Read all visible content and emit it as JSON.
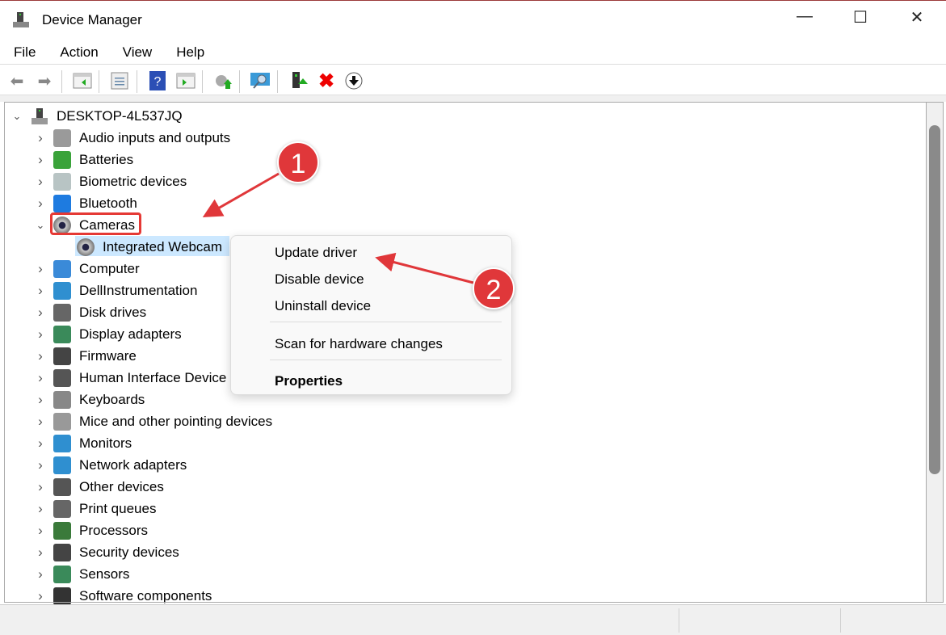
{
  "window": {
    "title": "Device Manager",
    "minimize": "—",
    "maximize": "☐",
    "close": "✕"
  },
  "menu": [
    "File",
    "Action",
    "View",
    "Help"
  ],
  "toolbar": [
    "back-icon",
    "forward-icon",
    "show-hide-console-tree-icon",
    "properties-icon",
    "help-icon",
    "action-pane-icon",
    "update-driver-icon",
    "scan-hardware-icon",
    "enable-device-icon",
    "uninstall-device-icon",
    "disable-device-icon"
  ],
  "tree": {
    "root": "DESKTOP-4L537JQ",
    "items": [
      {
        "label": "Audio inputs and outputs",
        "color": "#9a9a9a"
      },
      {
        "label": "Batteries",
        "color": "#3aa33a"
      },
      {
        "label": "Biometric devices",
        "color": "#b8c4c4"
      },
      {
        "label": "Bluetooth",
        "color": "#1e7be0"
      },
      {
        "label": "Cameras",
        "color": "#777777",
        "expanded": true
      },
      {
        "label": "Integrated Webcam",
        "color": "#777777",
        "child": true
      },
      {
        "label": "Computer",
        "color": "#3a8ad8"
      },
      {
        "label": "DellInstrumentation",
        "color": "#2f8fd0"
      },
      {
        "label": "Disk drives",
        "color": "#666666"
      },
      {
        "label": "Display adapters",
        "color": "#3a8a5a"
      },
      {
        "label": "Firmware",
        "color": "#444444"
      },
      {
        "label": "Human Interface Device",
        "color": "#555555"
      },
      {
        "label": "Keyboards",
        "color": "#888888"
      },
      {
        "label": "Mice and other pointing devices",
        "color": "#999999"
      },
      {
        "label": "Monitors",
        "color": "#2f8fd0"
      },
      {
        "label": "Network adapters",
        "color": "#2f8fd0"
      },
      {
        "label": "Other devices",
        "color": "#555555"
      },
      {
        "label": "Print queues",
        "color": "#666666"
      },
      {
        "label": "Processors",
        "color": "#3a7a3a"
      },
      {
        "label": "Security devices",
        "color": "#444444"
      },
      {
        "label": "Sensors",
        "color": "#3a8a5a"
      },
      {
        "label": "Software components",
        "color": "#333333"
      }
    ]
  },
  "context_menu": {
    "items": [
      "Update driver",
      "Disable device",
      "Uninstall device",
      "Scan for hardware changes",
      "Properties"
    ]
  },
  "annotations": {
    "step1": "1",
    "step2": "2",
    "color": "#e0373a"
  }
}
